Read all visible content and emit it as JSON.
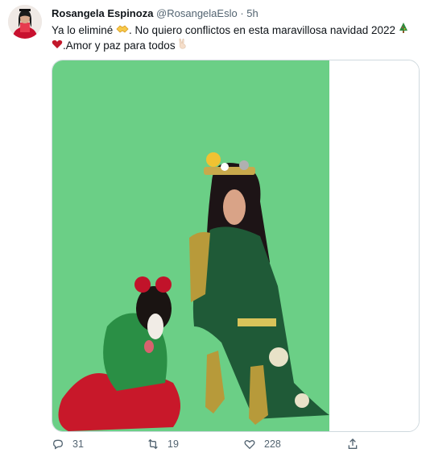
{
  "author": {
    "display_name": "Rosangela Espinoza",
    "handle": "@RosangelaEslo",
    "separator": "·",
    "time": "5h"
  },
  "tweet": {
    "text_part1": "Ya lo eliminé ",
    "text_part2": ". No quiero conflictos en esta maravillosa navidad 2022 ",
    "text_part3": ".Amor y paz para todos ",
    "emojis": [
      "handshake-emoji",
      "christmas-tree-emoji",
      "red-heart-emoji",
      "victory-hand-emoji"
    ]
  },
  "metrics": {
    "replies": "31",
    "retweets": "19",
    "likes": "228"
  },
  "colors": {
    "background": "#ffffff",
    "text": "#0f1419",
    "secondary_text": "#536471",
    "media_backdrop": "#6bcf86",
    "border": "#cfd9de"
  },
  "icons": [
    "reply-icon",
    "retweet-icon",
    "like-icon",
    "share-icon"
  ]
}
